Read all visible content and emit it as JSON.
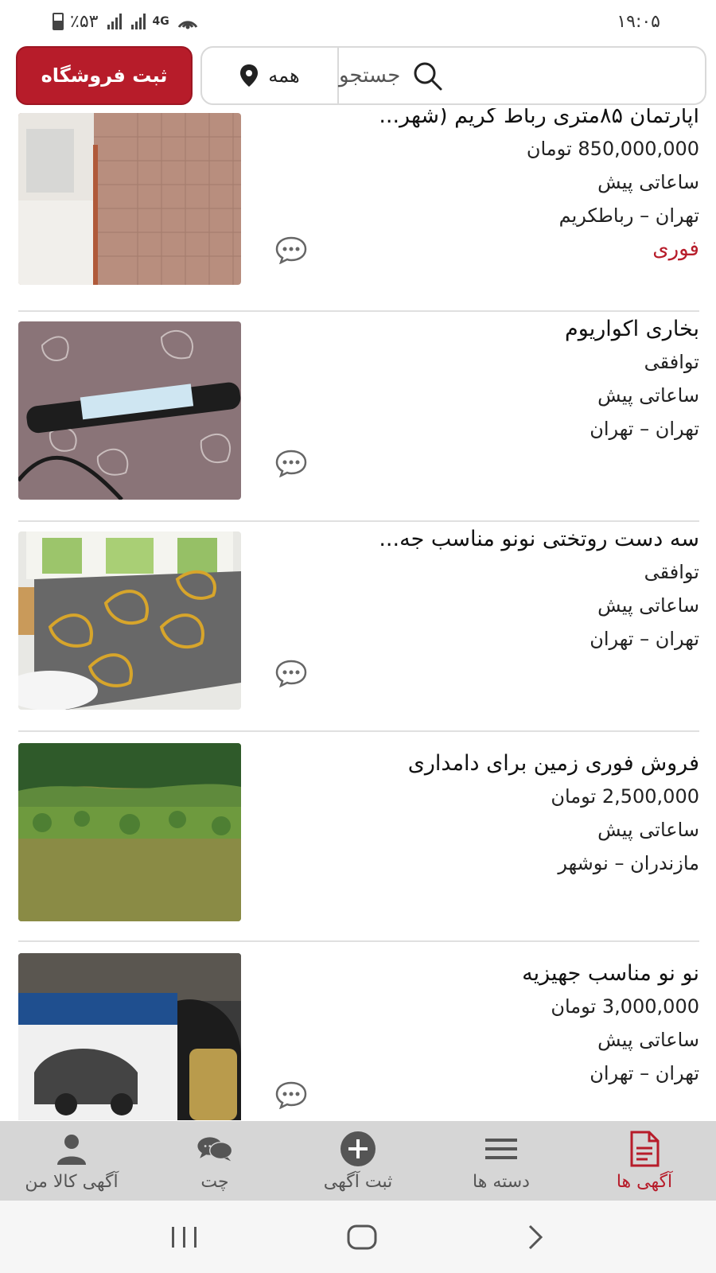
{
  "status_bar": {
    "time": "۱۹:۰۵",
    "battery": "٪۵۳",
    "network": "4G"
  },
  "header": {
    "store_button": "ثبت فروشگاه",
    "city": "همه",
    "search_placeholder": "جستجو"
  },
  "listings": [
    {
      "title": "آپارتمان ۸۵متری رباط کریم (شهر...",
      "price": "850,000,000 تومان",
      "time": "ساعاتی پیش",
      "location": "تهران – رباطکریم",
      "badge": "فوری"
    },
    {
      "title": "بخاری اکواریوم",
      "price": "توافقی",
      "time": "ساعاتی پیش",
      "location": "تهران – تهران"
    },
    {
      "title": "سه دست روتختی نونو مناسب جه...",
      "price": "توافقی",
      "time": "ساعاتی پیش",
      "location": "تهران – تهران"
    },
    {
      "title": "فروش فوری زمین برای دامداری",
      "price": "2,500,000 تومان",
      "time": "ساعاتی پیش",
      "location": "مازندران – نوشهر"
    },
    {
      "title": "نو نو مناسب جهیزیه",
      "price": "3,000,000 تومان",
      "time": "ساعاتی پیش",
      "location": "تهران – تهران"
    }
  ],
  "bottom_nav": {
    "ads": "آگهی ها",
    "categories": "دسته ها",
    "post_ad": "ثبت آگهی",
    "chat": "چت",
    "my_ads": "آگهی کالا من"
  },
  "colors": {
    "accent": "#b71c2a",
    "nav_bg": "#d6d6d6"
  }
}
